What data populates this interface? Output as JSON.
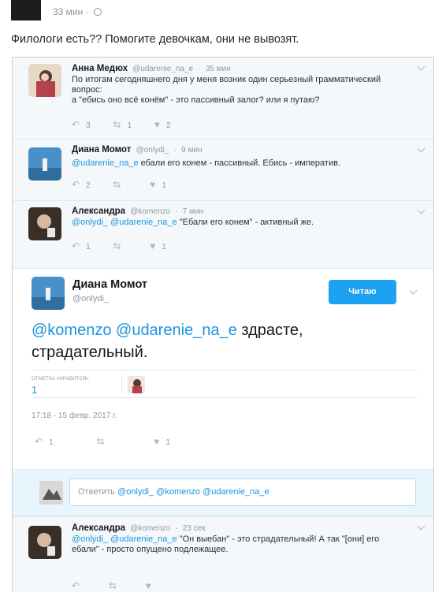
{
  "post": {
    "time": "33 мин",
    "separator": "·",
    "text": "Филологи есть?? Помогите девочкам, они не вывозят."
  },
  "replies": [
    {
      "name": "Анна Медюх",
      "handle": "@udarenie_na_e",
      "time": "35 мин",
      "text_lines": [
        "По итогам сегодняшнего дня у меня возник один серьезный грамматический",
        "вопрос:",
        "а \"ебись оно всё конём\" - это пассивный залог? или я путаю?"
      ],
      "replies_count": "3",
      "retweets": "1",
      "likes": "2"
    },
    {
      "name": "Диана Момот",
      "handle": "@onlydi_",
      "time": "9 мин",
      "mention": "@udarenie_na_e",
      "text": "ебали его конем - пассивный. Ебись - императив.",
      "replies_count": "2",
      "retweets": "",
      "likes": "1"
    },
    {
      "name": "Александра",
      "handle": "@komenzo",
      "time": "7 мин",
      "mention": "@onlydi_ @udarenie_na_e",
      "text": "\"Ебали его конем\" - активный же.",
      "replies_count": "1",
      "retweets": "",
      "likes": "1"
    },
    {
      "name": "Александра",
      "handle": "@komenzo",
      "time": "23 сек",
      "mention": "@onlydi_ @udarenie_na_e",
      "text_first": "\"Он выебан\" - это страдательный! А так \"[они] его",
      "text_second": "ебали\" - просто опущено подлежащее.",
      "replies_count": "",
      "retweets": "",
      "likes": ""
    }
  ],
  "main_tweet": {
    "name": "Диана Момот",
    "handle": "@onlydi_",
    "follow_label": "Читаю",
    "mention": "@komenzo @udarenie_na_e",
    "text_rest": "здрасте,",
    "text_line2": "страдательный.",
    "likes_label": "ОТМЕТКА «НРАВИТСЯ»",
    "likes_count": "1",
    "timestamp": "17:18 - 15 февр. 2017 г.",
    "replies_count": "1",
    "likes": "1"
  },
  "compose": {
    "prefix": "Ответить",
    "mentions": "@onlydi_ @komenzo @udarenie_na_e"
  },
  "colors": {
    "accent": "#1da1f2",
    "mention": "#1b95e0",
    "reply_bg": "#f5f8fa",
    "compose_bg": "#e8f5fd"
  },
  "icons": [
    "globe-icon",
    "reply-icon",
    "retweet-icon",
    "heart-icon",
    "chevron-down-icon"
  ]
}
